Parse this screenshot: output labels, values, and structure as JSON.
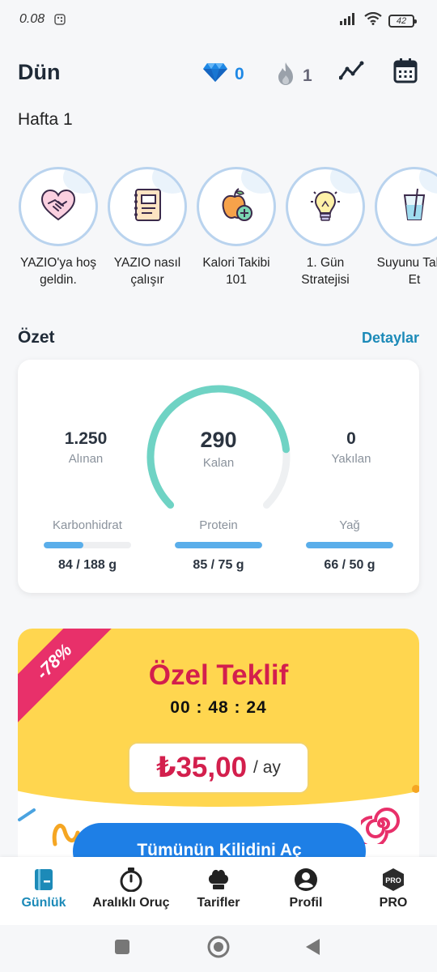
{
  "status_bar": {
    "time": "0.08",
    "battery": "42"
  },
  "header": {
    "title": "Dün",
    "gems": "0",
    "streak": "1"
  },
  "week": "Hafta 1",
  "stories": [
    {
      "label": "YAZIO'ya hoş geldin.",
      "icon": "handshake-heart-icon"
    },
    {
      "label": "YAZIO nasıl çalışır",
      "icon": "notebook-icon"
    },
    {
      "label": "Kalori Takibi 101",
      "icon": "apple-plus-icon"
    },
    {
      "label": "1. Gün Stratejisi",
      "icon": "lightbulb-icon"
    },
    {
      "label": "Suyunu Takip Et",
      "icon": "water-glass-icon"
    }
  ],
  "summary": {
    "title": "Özet",
    "details_link": "Detaylar",
    "eaten_value": "1.250",
    "eaten_label": "Alınan",
    "remaining_value": "290",
    "remaining_label": "Kalan",
    "burned_value": "0",
    "burned_label": "Yakılan",
    "gauge_progress": 0.81,
    "macros": [
      {
        "label": "Karbonhidrat",
        "value": "84 / 188 g",
        "progress": 0.45
      },
      {
        "label": "Protein",
        "value": "85 / 75 g",
        "progress": 1.0
      },
      {
        "label": "Yağ",
        "value": "66 / 50 g",
        "progress": 1.0
      }
    ]
  },
  "promo": {
    "discount": "-78%",
    "title": "Özel Teklif",
    "timer": "00 : 48 : 24",
    "price": "₺35,00",
    "price_unit": "/ ay",
    "button": "Tümünün Kilidini Aç"
  },
  "bottom_nav": [
    {
      "label": "Günlük",
      "icon": "diary-icon",
      "active": true
    },
    {
      "label": "Aralıklı Oruç",
      "icon": "stopwatch-icon",
      "active": false
    },
    {
      "label": "Tarifler",
      "icon": "chef-hat-icon",
      "active": false
    },
    {
      "label": "Profil",
      "icon": "profile-icon",
      "active": false
    },
    {
      "label": "PRO",
      "icon": "pro-badge-icon",
      "active": false
    }
  ],
  "colors": {
    "accent": "#1c8ab8",
    "gauge": "#6fd3c4",
    "macro_bar": "#5aaeea",
    "promo_yellow": "#ffd64f",
    "promo_red": "#d31f4d",
    "button_blue": "#1e7fe6"
  }
}
